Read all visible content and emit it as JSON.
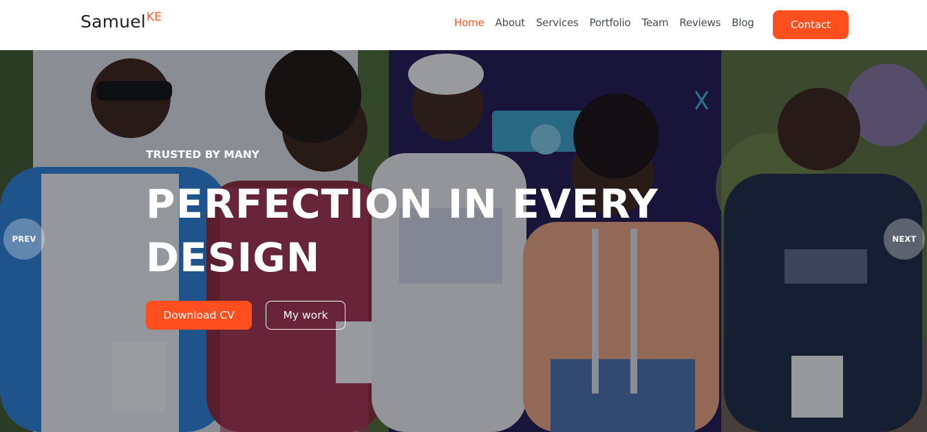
{
  "brand": {
    "name": "Samuel",
    "suffix": "KE",
    "accent_color": "#ff4f1f"
  },
  "nav": {
    "items": [
      {
        "label": "Home",
        "active": true
      },
      {
        "label": "About",
        "active": false
      },
      {
        "label": "Services",
        "active": false
      },
      {
        "label": "Portfolio",
        "active": false
      },
      {
        "label": "Team",
        "active": false
      },
      {
        "label": "Reviews",
        "active": false
      },
      {
        "label": "Blog",
        "active": false
      }
    ],
    "contact_label": "Contact"
  },
  "hero": {
    "eyebrow": "TRUSTED BY MANY",
    "title_line1": "PERFECTION IN EVERY",
    "title_line2": "DESIGN",
    "primary_button": "Download CV",
    "secondary_button": "My work",
    "prev_label": "PREV",
    "next_label": "NEXT",
    "background": "group-photo-five-people"
  }
}
